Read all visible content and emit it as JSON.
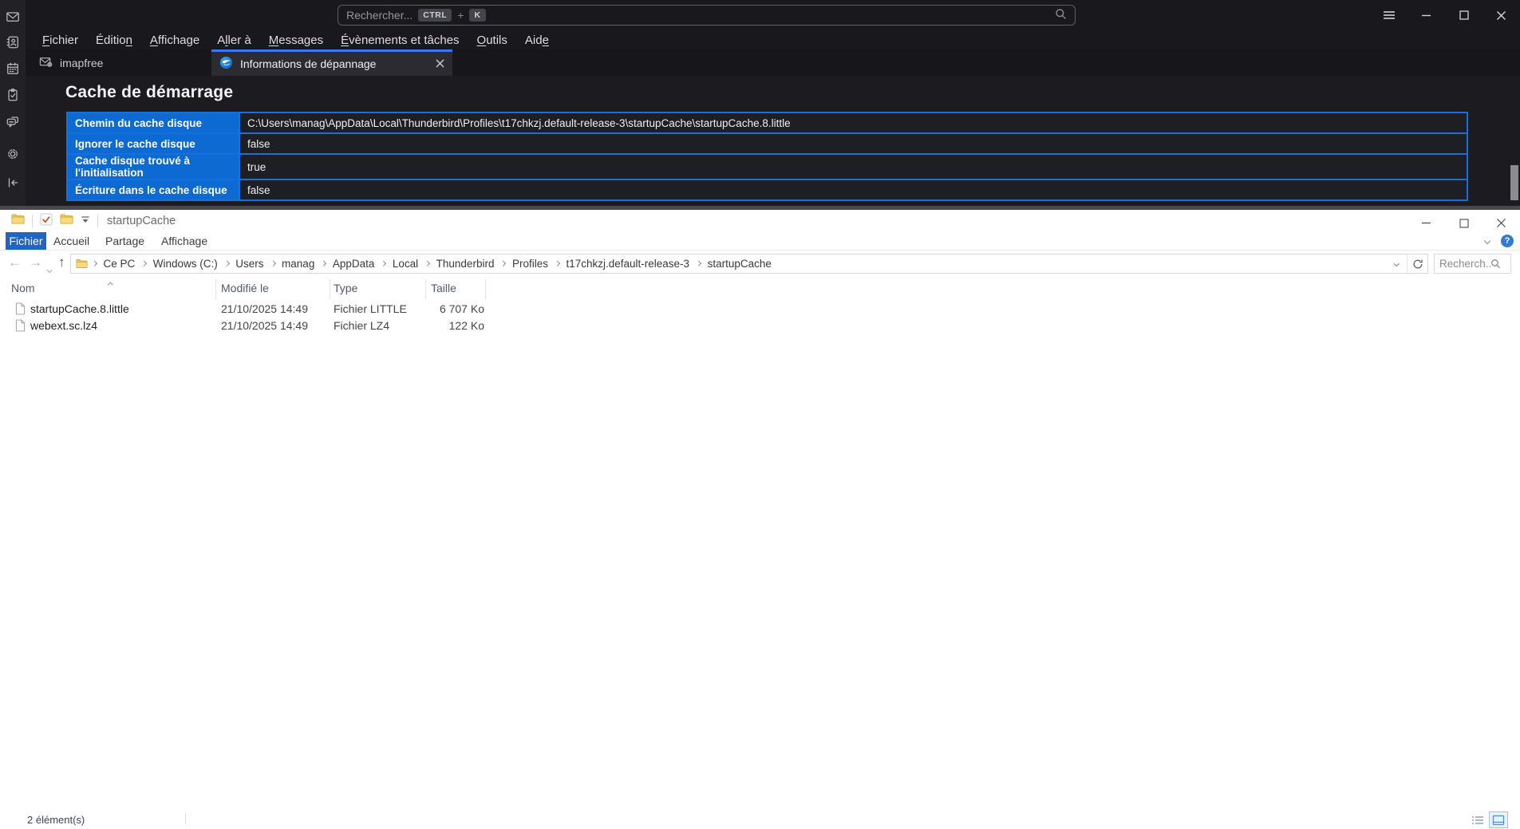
{
  "colors": {
    "tb_accent": "#3a77f2",
    "tb_table_header_blue": "#0d6ad2",
    "tb_table_border_blue": "#1571de",
    "explorer_file_tab_blue": "#2064c4",
    "help_icon_blue": "#2f7bd5"
  },
  "thunderbird": {
    "search": {
      "placeholder": "Rechercher...",
      "key1": "CTRL",
      "plus": "+",
      "key2": "K"
    },
    "menubar": [
      {
        "label": "Fichier",
        "key": "F"
      },
      {
        "label": "Édition",
        "key": "n"
      },
      {
        "label": "Affichage",
        "key": "A"
      },
      {
        "label": "Aller à",
        "key": "l"
      },
      {
        "label": "Messages",
        "key": "M"
      },
      {
        "label": "Évènements et tâches",
        "key": "É"
      },
      {
        "label": "Outils",
        "key": "O"
      },
      {
        "label": "Aide",
        "key": "e"
      }
    ],
    "tabs": {
      "mail_tab": "imapfree",
      "active_tab": "Informations de dépannage"
    },
    "page": {
      "title": "Cache de démarrage",
      "table_rows": [
        {
          "label": "Chemin du cache disque",
          "value": "C:\\Users\\manag\\AppData\\Local\\Thunderbird\\Profiles\\t17chkzj.default-release-3\\startupCache\\startupCache.8.little"
        },
        {
          "label": "Ignorer le cache disque",
          "value": "false"
        },
        {
          "label": "Cache disque trouvé à l'initialisation",
          "value": "true"
        },
        {
          "label": "Écriture dans le cache disque",
          "value": "false"
        }
      ]
    }
  },
  "explorer": {
    "title": "startupCache",
    "ribbon_tabs": [
      "Fichier",
      "Accueil",
      "Partage",
      "Affichage"
    ],
    "help_glyph": "?",
    "breadcrumb": [
      "Ce PC",
      "Windows (C:)",
      "Users",
      "manag",
      "AppData",
      "Local",
      "Thunderbird",
      "Profiles",
      "t17chkzj.default-release-3",
      "startupCache"
    ],
    "search_placeholder": "Recherch...",
    "columns": [
      "Nom",
      "Modifié le",
      "Type",
      "Taille"
    ],
    "files": [
      {
        "name": "startupCache.8.little",
        "modified": "21/10/2025 14:49",
        "type": "Fichier LITTLE",
        "size": "6 707 Ko"
      },
      {
        "name": "webext.sc.lz4",
        "modified": "21/10/2025 14:49",
        "type": "Fichier LZ4",
        "size": "122 Ko"
      }
    ],
    "status_count": "2 élément(s)"
  }
}
